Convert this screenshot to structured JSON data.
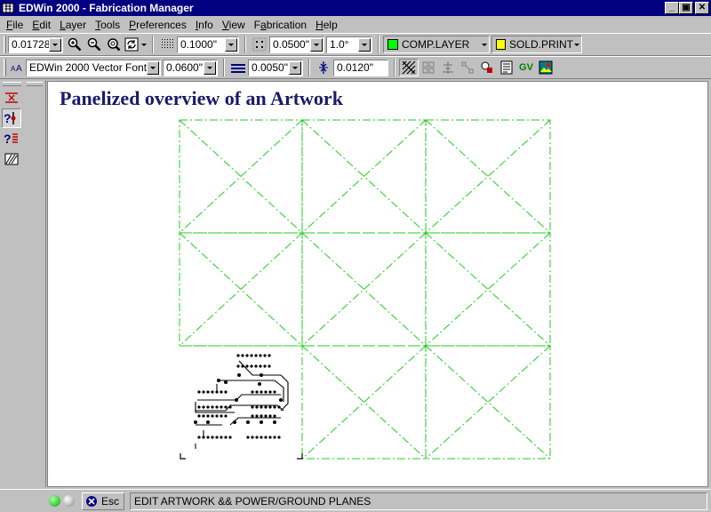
{
  "window": {
    "title": "EDWin 2000 - Fabrication Manager",
    "min_glyph": "_",
    "max_glyph": "▣",
    "close_glyph": "✕"
  },
  "menu": [
    {
      "label": "File",
      "accel": "F",
      "rest": "ile"
    },
    {
      "label": "Edit",
      "accel": "E",
      "rest": "dit"
    },
    {
      "label": "Layer",
      "accel": "L",
      "rest": "ayer"
    },
    {
      "label": "Tools",
      "accel": "T",
      "rest": "ools"
    },
    {
      "label": "Preferences",
      "accel": "P",
      "rest": "references"
    },
    {
      "label": "Info",
      "accel": "I",
      "rest": "nfo"
    },
    {
      "label": "View",
      "accel": "V",
      "rest": "iew"
    },
    {
      "label": "Fabrication",
      "accel": "a",
      "pre": "F",
      "rest": "brication"
    },
    {
      "label": "Help",
      "accel": "H",
      "rest": "elp"
    }
  ],
  "toolbar1": {
    "zoom_value": "0.01728\"",
    "grid_value": "0.1000\"",
    "snap_value": "0.0500\"",
    "angle_value": "1.0°",
    "comp_layer": "COMP.LAYER",
    "comp_color": "#00ff00",
    "print_layer": "SOLD.PRINT",
    "print_color": "#ffff00"
  },
  "toolbar2": {
    "font_name": "EDWin 2000 Vector Font",
    "font_size": "0.0600\"",
    "line_width": "0.0050\"",
    "clearance": "0.0120\"",
    "gv_label": "GV"
  },
  "canvas": {
    "title": "Panelized overview of an Artwork",
    "grid_color": "#22cc22"
  },
  "status": {
    "esc_label": "Esc",
    "message": "EDIT ARTWORK && POWER/GROUND PLANES"
  }
}
